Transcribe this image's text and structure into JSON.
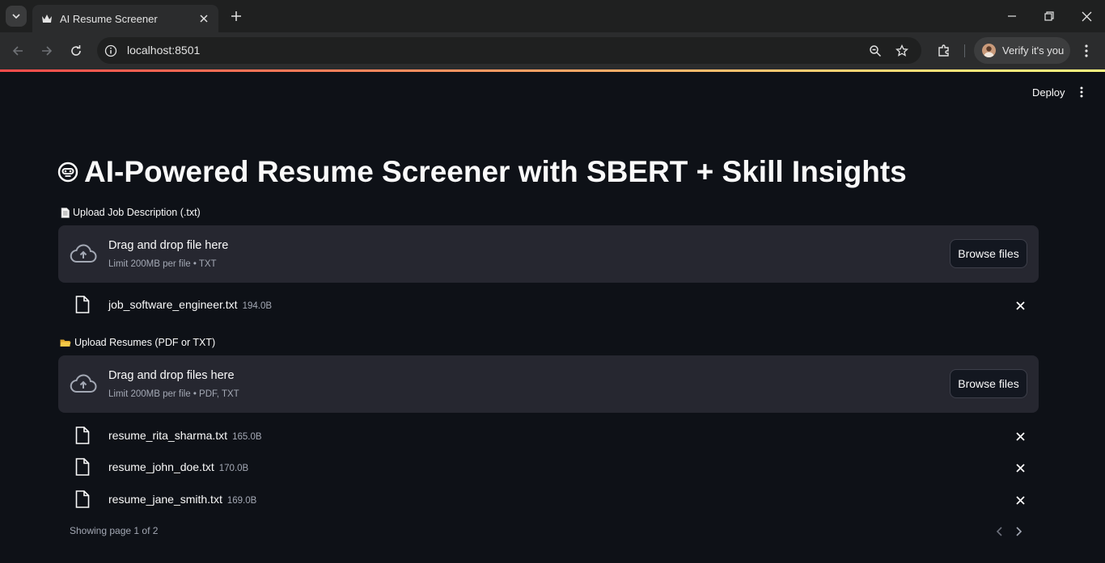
{
  "browser": {
    "tab_title": "AI Resume Screener",
    "url": "localhost:8501",
    "profile_label": "Verify it's you"
  },
  "app": {
    "deploy_label": "Deploy",
    "title": "AI-Powered Resume Screener with SBERT + Skill Insights",
    "title_icon": "robot-face-icon",
    "accent_colors": [
      "#ff4b4b",
      "#fffd80"
    ]
  },
  "job_upload": {
    "label": "Upload Job Description (.txt)",
    "label_icon": "page-icon",
    "drop_text": "Drag and drop file here",
    "limit_text": "Limit 200MB per file • TXT",
    "browse_label": "Browse files",
    "files": [
      {
        "name": "job_software_engineer.txt",
        "size": "194.0B"
      }
    ]
  },
  "resume_upload": {
    "label": "Upload Resumes (PDF or TXT)",
    "label_icon": "folder-icon",
    "drop_text": "Drag and drop files here",
    "limit_text": "Limit 200MB per file • PDF, TXT",
    "browse_label": "Browse files",
    "files": [
      {
        "name": "resume_rita_sharma.txt",
        "size": "165.0B"
      },
      {
        "name": "resume_john_doe.txt",
        "size": "170.0B"
      },
      {
        "name": "resume_jane_smith.txt",
        "size": "169.0B"
      }
    ],
    "pagination_text": "Showing page 1 of 2"
  }
}
